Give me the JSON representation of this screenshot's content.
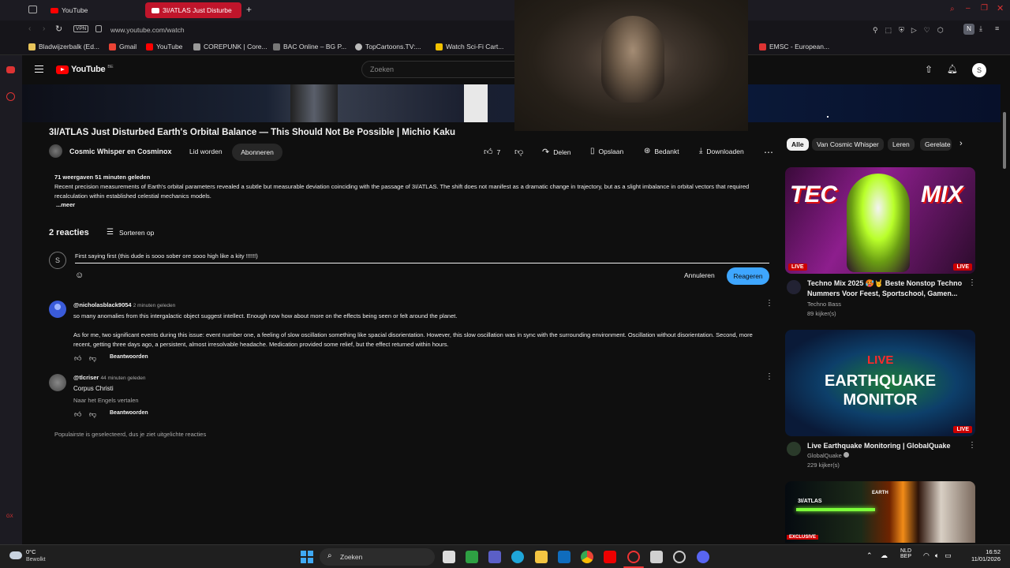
{
  "browser": {
    "tabs": [
      {
        "label": "YouTube"
      },
      {
        "label": "3I/ATLAS Just Disturbe"
      }
    ],
    "url": "www.youtube.com/watch",
    "vpn_label": "VPN",
    "bookmarks": [
      {
        "label": "Bladwijzerbalk (Ed...",
        "color": "#e8c45a"
      },
      {
        "label": "Gmail",
        "color": "#ea4335"
      },
      {
        "label": "YouTube",
        "color": "#ff0000"
      },
      {
        "label": "COREPUNK | Core...",
        "color": "#999999"
      },
      {
        "label": "BAC Online – BG P...",
        "color": "#777777"
      },
      {
        "label": "TopCartoons.TV:...",
        "color": "#bbbbbb"
      },
      {
        "label": "Watch Sci-Fi Cart...",
        "color": "#f2c200"
      },
      {
        "label": "EMSC - European...",
        "color": "#d33"
      }
    ],
    "profile_letter": "N"
  },
  "youtube": {
    "logo": "YouTube",
    "country": "BE",
    "search_placeholder": "Zoeken",
    "avatar_letter": "S",
    "video_title": "3I/ATLAS Just Disturbed Earth's Orbital Balance — This Should Not Be Possible | Michio Kaku",
    "channel": "Cosmic Whisper en Cosminox",
    "join_label": "Lid worden",
    "subscribe_label": "Abonneren",
    "like_count": "7",
    "share_label": "Delen",
    "save_label": "Opslaan",
    "thanks_label": "Bedankt",
    "download_label": "Downloaden",
    "description": {
      "stats": "71 weergaven  51 minuten geleden",
      "text": "Recent precision measurements of Earth's orbital parameters revealed a subtle but measurable deviation coinciding with the passage of 3I/ATLAS. The shift does not manifest as a dramatic change in trajectory, but as a slight imbalance in orbital vectors that required recalculation within established celestial mechanics models.",
      "more": "...meer"
    },
    "comments": {
      "count_label": "2 reacties",
      "sort_label": "Sorteren op",
      "draft_avatar": "S",
      "draft_text": "First saying first (this dude is sooo sober ore sooo high like a kity !!!!!!)",
      "cancel_label": "Annuleren",
      "reply_label": "Reageren",
      "items": [
        {
          "author": "@nicholasblack9054",
          "time": "2 minuten geleden",
          "line1": "so many anomalies from this intergalactic object suggest intellect. Enough now how about more on the effects being seen or felt around the planet.",
          "line2": "As for me, two significant events during this issue: event number one, a feeling of slow oscillation something like spacial disorientation. However, this slow oscillation was in sync with the surrounding environment. Oscillation without disorientation. Second, more recent, getting three days ago, a persistent, almost irresolvable headache. Medication provided some relief, but the effect returned within hours.",
          "reply": "Beantwoorden"
        },
        {
          "author": "@tlcriser",
          "time": "44 minuten geleden",
          "line1": "Corpus Christi",
          "translate": "Naar het Engels vertalen",
          "reply": "Beantwoorden"
        }
      ],
      "footer": "Populairste is geselecteerd, dus je ziet uitgelichte reacties"
    },
    "chips": [
      {
        "label": "Alle",
        "active": true
      },
      {
        "label": "Van Cosmic Whisper",
        "active": false
      },
      {
        "label": "Leren",
        "active": false
      },
      {
        "label": "Gerelate",
        "active": false
      }
    ],
    "recommended": [
      {
        "title": "Techno Mix 2025 🥵🤘 Beste Nonstop Techno Nummers Voor Feest, Sportschool, Gamen...",
        "channel": "Techno Bass",
        "meta": "89 kijker(s)",
        "thumb_text_left": "TEC",
        "thumb_text_right": "MIX",
        "badge": "LIVE"
      },
      {
        "title": "Live Earthquake Monitoring | GlobalQuake",
        "channel": "GlobalQuake",
        "meta": "229 kijker(s)",
        "thumb_live": "LIVE",
        "thumb_line1": "EARTHQUAKE",
        "thumb_line2": "MONITOR",
        "badge": "LIVE"
      },
      {
        "thumb_label": "3I/ATLAS",
        "thumb_label2": "EARTH",
        "thumb_badge": "EXCLUSIVE"
      }
    ]
  },
  "taskbar": {
    "weather_temp": "0°C",
    "weather_text": "Bewolkt",
    "search_label": "Zoeken",
    "lang1": "NLD",
    "lang2": "BEP",
    "time": "16:52",
    "date": "11/01/2026"
  }
}
